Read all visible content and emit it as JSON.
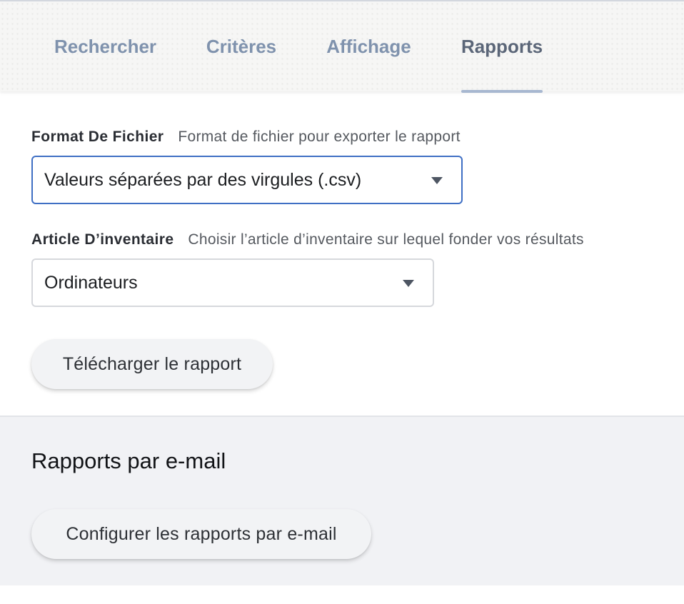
{
  "tabs": [
    {
      "label": "Rechercher",
      "active": false
    },
    {
      "label": "Critères",
      "active": false
    },
    {
      "label": "Affichage",
      "active": false
    },
    {
      "label": "Rapports",
      "active": true
    }
  ],
  "file_format": {
    "label": "Format De Fichier",
    "hint": "Format de fichier pour exporter le rapport",
    "value": "Valeurs séparées par des virgules (.csv)"
  },
  "inventory_item": {
    "label": "Article D’inventaire",
    "hint": "Choisir l’article d’inventaire sur lequel fonder vos résultats",
    "value": "Ordinateurs"
  },
  "download_button": "Télécharger le rapport",
  "email_reports": {
    "title": "Rapports par e-mail",
    "configure_button": "Configurer les rapports par e-mail"
  },
  "colors": {
    "accent": "#3f6fc4",
    "tab_inactive": "#7f92ad",
    "tab_active": "#5b6678",
    "tab_underline": "#a7b7d0"
  },
  "icons": [
    "chevron-down-icon"
  ]
}
